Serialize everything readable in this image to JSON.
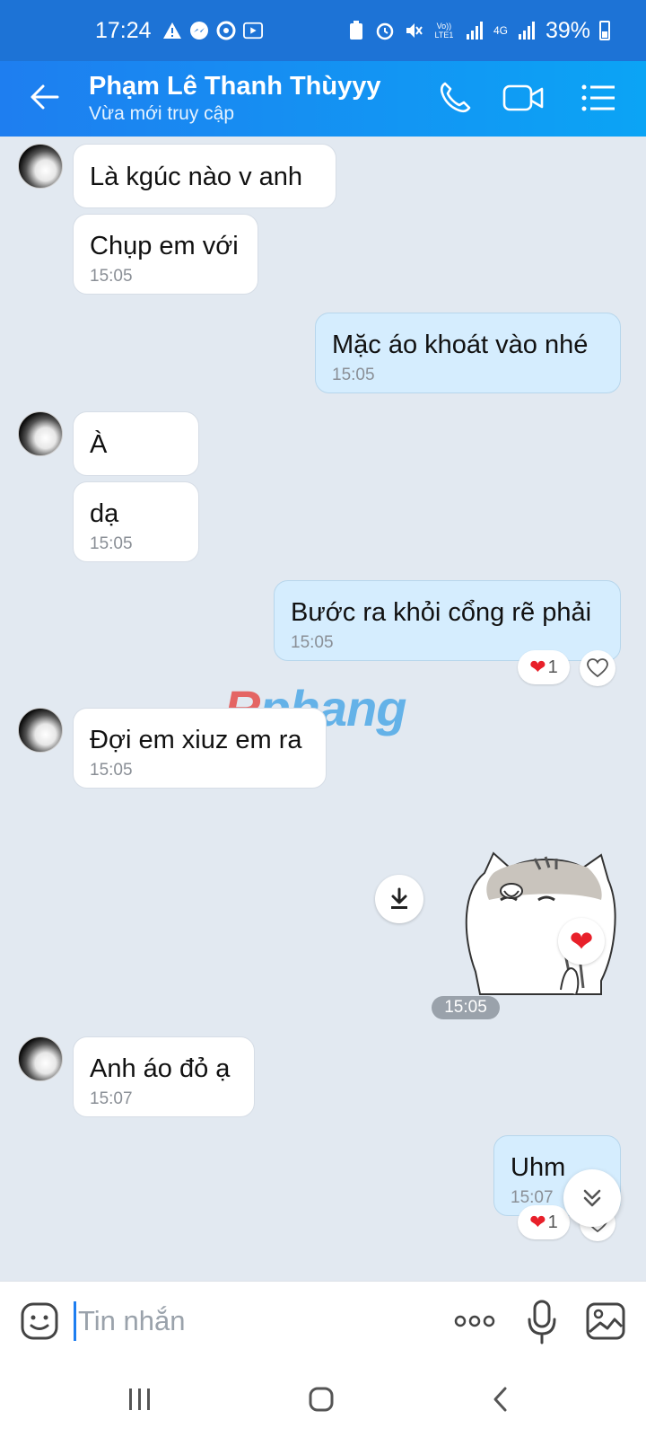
{
  "status_bar": {
    "time": "17:24",
    "battery": "39%",
    "network_label": "4G",
    "volte_label": "Vo)) LTE1",
    "icons": [
      "warning-icon",
      "messenger-icon",
      "app-icon",
      "video-icon",
      "recycle-icon",
      "alarm-icon",
      "mute-icon",
      "signal-icon",
      "battery-icon"
    ]
  },
  "header": {
    "title": "Phạm Lê Thanh Thùyyy",
    "subtitle": "Vừa mới truy cập",
    "icons": [
      "back-arrow-icon",
      "phone-icon",
      "video-call-icon",
      "menu-list-icon"
    ]
  },
  "messages": [
    {
      "text": "Là kgúc nào v anh",
      "time": ""
    },
    {
      "text": "Chụp em với",
      "time": "15:05"
    },
    {
      "text": "Mặc áo khoát vào nhé",
      "time": "15:05"
    },
    {
      "text": "À",
      "time": ""
    },
    {
      "text": "dạ",
      "time": "15:05"
    },
    {
      "text": "Bước ra khỏi cổng rẽ phải",
      "time": "15:05",
      "reaction_count": "1"
    },
    {
      "text": "Đợi em xiuz em ra",
      "time": "15:05"
    },
    {
      "text": "Anh áo đỏ ạ",
      "time": "15:07"
    },
    {
      "text": "Uhm",
      "time": "15:07",
      "reaction_count": "1"
    }
  ],
  "sticker": {
    "time": "15:05",
    "reaction": "heart"
  },
  "watermark": {
    "first": "R",
    "rest": "phang"
  },
  "input": {
    "placeholder": "Tin nhắn"
  },
  "colors": {
    "header_start": "#1e7ef0",
    "header_end": "#0ba4f5",
    "chat_bg": "#e2e9f1",
    "sent_bubble": "#d5edfe",
    "heart": "#e8202a"
  }
}
